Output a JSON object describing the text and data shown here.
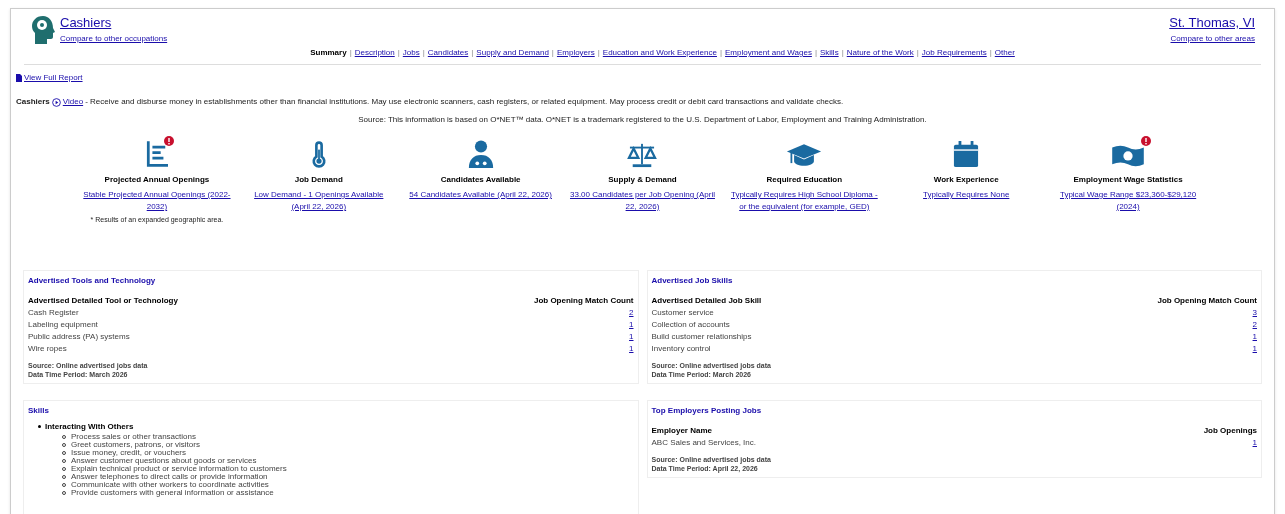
{
  "header": {
    "occupation": "Cashiers",
    "compare_occupations": "Compare to other occupations",
    "area": "St. Thomas, VI",
    "compare_areas": "Compare to other areas"
  },
  "nav": [
    {
      "label": "Summary",
      "selected": true
    },
    {
      "label": "Description",
      "selected": false
    },
    {
      "label": "Jobs",
      "selected": false
    },
    {
      "label": "Candidates",
      "selected": false
    },
    {
      "label": "Supply and Demand",
      "selected": false
    },
    {
      "label": "Employers",
      "selected": false
    },
    {
      "label": "Education and Work Experience",
      "selected": false
    },
    {
      "label": "Employment and Wages",
      "selected": false
    },
    {
      "label": "Skills",
      "selected": false
    },
    {
      "label": "Nature of the Work",
      "selected": false
    },
    {
      "label": "Job Requirements",
      "selected": false
    },
    {
      "label": "Other",
      "selected": false
    }
  ],
  "nav_separator": "|",
  "full_report": "View Full Report",
  "description": {
    "title": "Cashiers",
    "video": "Video",
    "text": "- Receive and disburse money in establishments other than financial institutions. May use electronic scanners, cash registers, or related equipment. May process credit or debit card transactions and validate checks."
  },
  "source": "Source: This information is based on O*NET™ data. O*NET is a trademark registered to the U.S. Department of Labor, Employment and Training Administration.",
  "stats": [
    {
      "kind": "chart",
      "title": "Projected Annual Openings",
      "link": "Stable Projected Annual Openings (2022-2032)",
      "alert": true,
      "note": "* Results of an expanded geographic area."
    },
    {
      "kind": "thermometer",
      "title": "Job Demand",
      "link": "Low Demand - 1 Openings Available (April 22, 2026)",
      "alert": false
    },
    {
      "kind": "person",
      "title": "Candidates Available",
      "link": "54 Candidates Available (April 22, 2026)",
      "alert": false
    },
    {
      "kind": "scale",
      "title": "Supply & Demand",
      "link": "33.00 Candidates per Job Opening (April 22, 2026)",
      "alert": false
    },
    {
      "kind": "cap",
      "title": "Required Education",
      "link": "Typically Requires High School Diploma - or the equivalent (for example, GED)",
      "alert": false
    },
    {
      "kind": "calendar",
      "title": "Work Experience",
      "link": "Typically Requires None",
      "alert": false
    },
    {
      "kind": "money",
      "title": "Employment Wage Statistics",
      "link": "Typical Wage Range $23,360-$29,120 (2024)",
      "alert": true
    }
  ],
  "tools": {
    "title": "Advertised Tools and Technology",
    "columns": [
      "Advertised Detailed Tool or Technology",
      "Job Opening Match Count"
    ],
    "rows": [
      [
        "Cash Register",
        "2"
      ],
      [
        "Labeling equipment",
        "1"
      ],
      [
        "Public address (PA) systems",
        "1"
      ],
      [
        "Wire ropes",
        "1"
      ]
    ],
    "source": "Source: Online advertised jobs data",
    "period": "Data Time Period: March 2026"
  },
  "job_skills": {
    "title": "Advertised Job Skills",
    "columns": [
      "Advertised Detailed Job Skill",
      "Job Opening Match Count"
    ],
    "rows": [
      [
        "Customer service",
        "3"
      ],
      [
        "Collection of accounts",
        "2"
      ],
      [
        "Build customer relationships",
        "1"
      ],
      [
        "Inventory control",
        "1"
      ]
    ],
    "source": "Source: Online advertised jobs data",
    "period": "Data Time Period: March 2026"
  },
  "skills": {
    "title": "Skills",
    "items": [
      {
        "label": "Interacting With Others",
        "children": [
          {
            "label": "Process sales or other transactions"
          },
          {
            "label": "Greet customers, patrons, or visitors"
          },
          {
            "label": "Issue money, credit, or vouchers"
          },
          {
            "label": "Answer customer questions about goods or services"
          },
          {
            "label": "Explain technical product or service information to customers"
          },
          {
            "label": "Answer telephones to direct calls or provide information"
          },
          {
            "label": "Communicate with other workers to coordinate activities"
          },
          {
            "label": "Provide customers with general information or assistance"
          }
        ]
      }
    ]
  },
  "employers": {
    "title": "Top Employers Posting Jobs",
    "columns": [
      "Employer Name",
      "Job Openings"
    ],
    "rows": [
      [
        "ABC Sales and Services, Inc.",
        "1"
      ]
    ],
    "source": "Source: Online advertised jobs data",
    "period": "Data Time Period: April 22, 2026"
  }
}
